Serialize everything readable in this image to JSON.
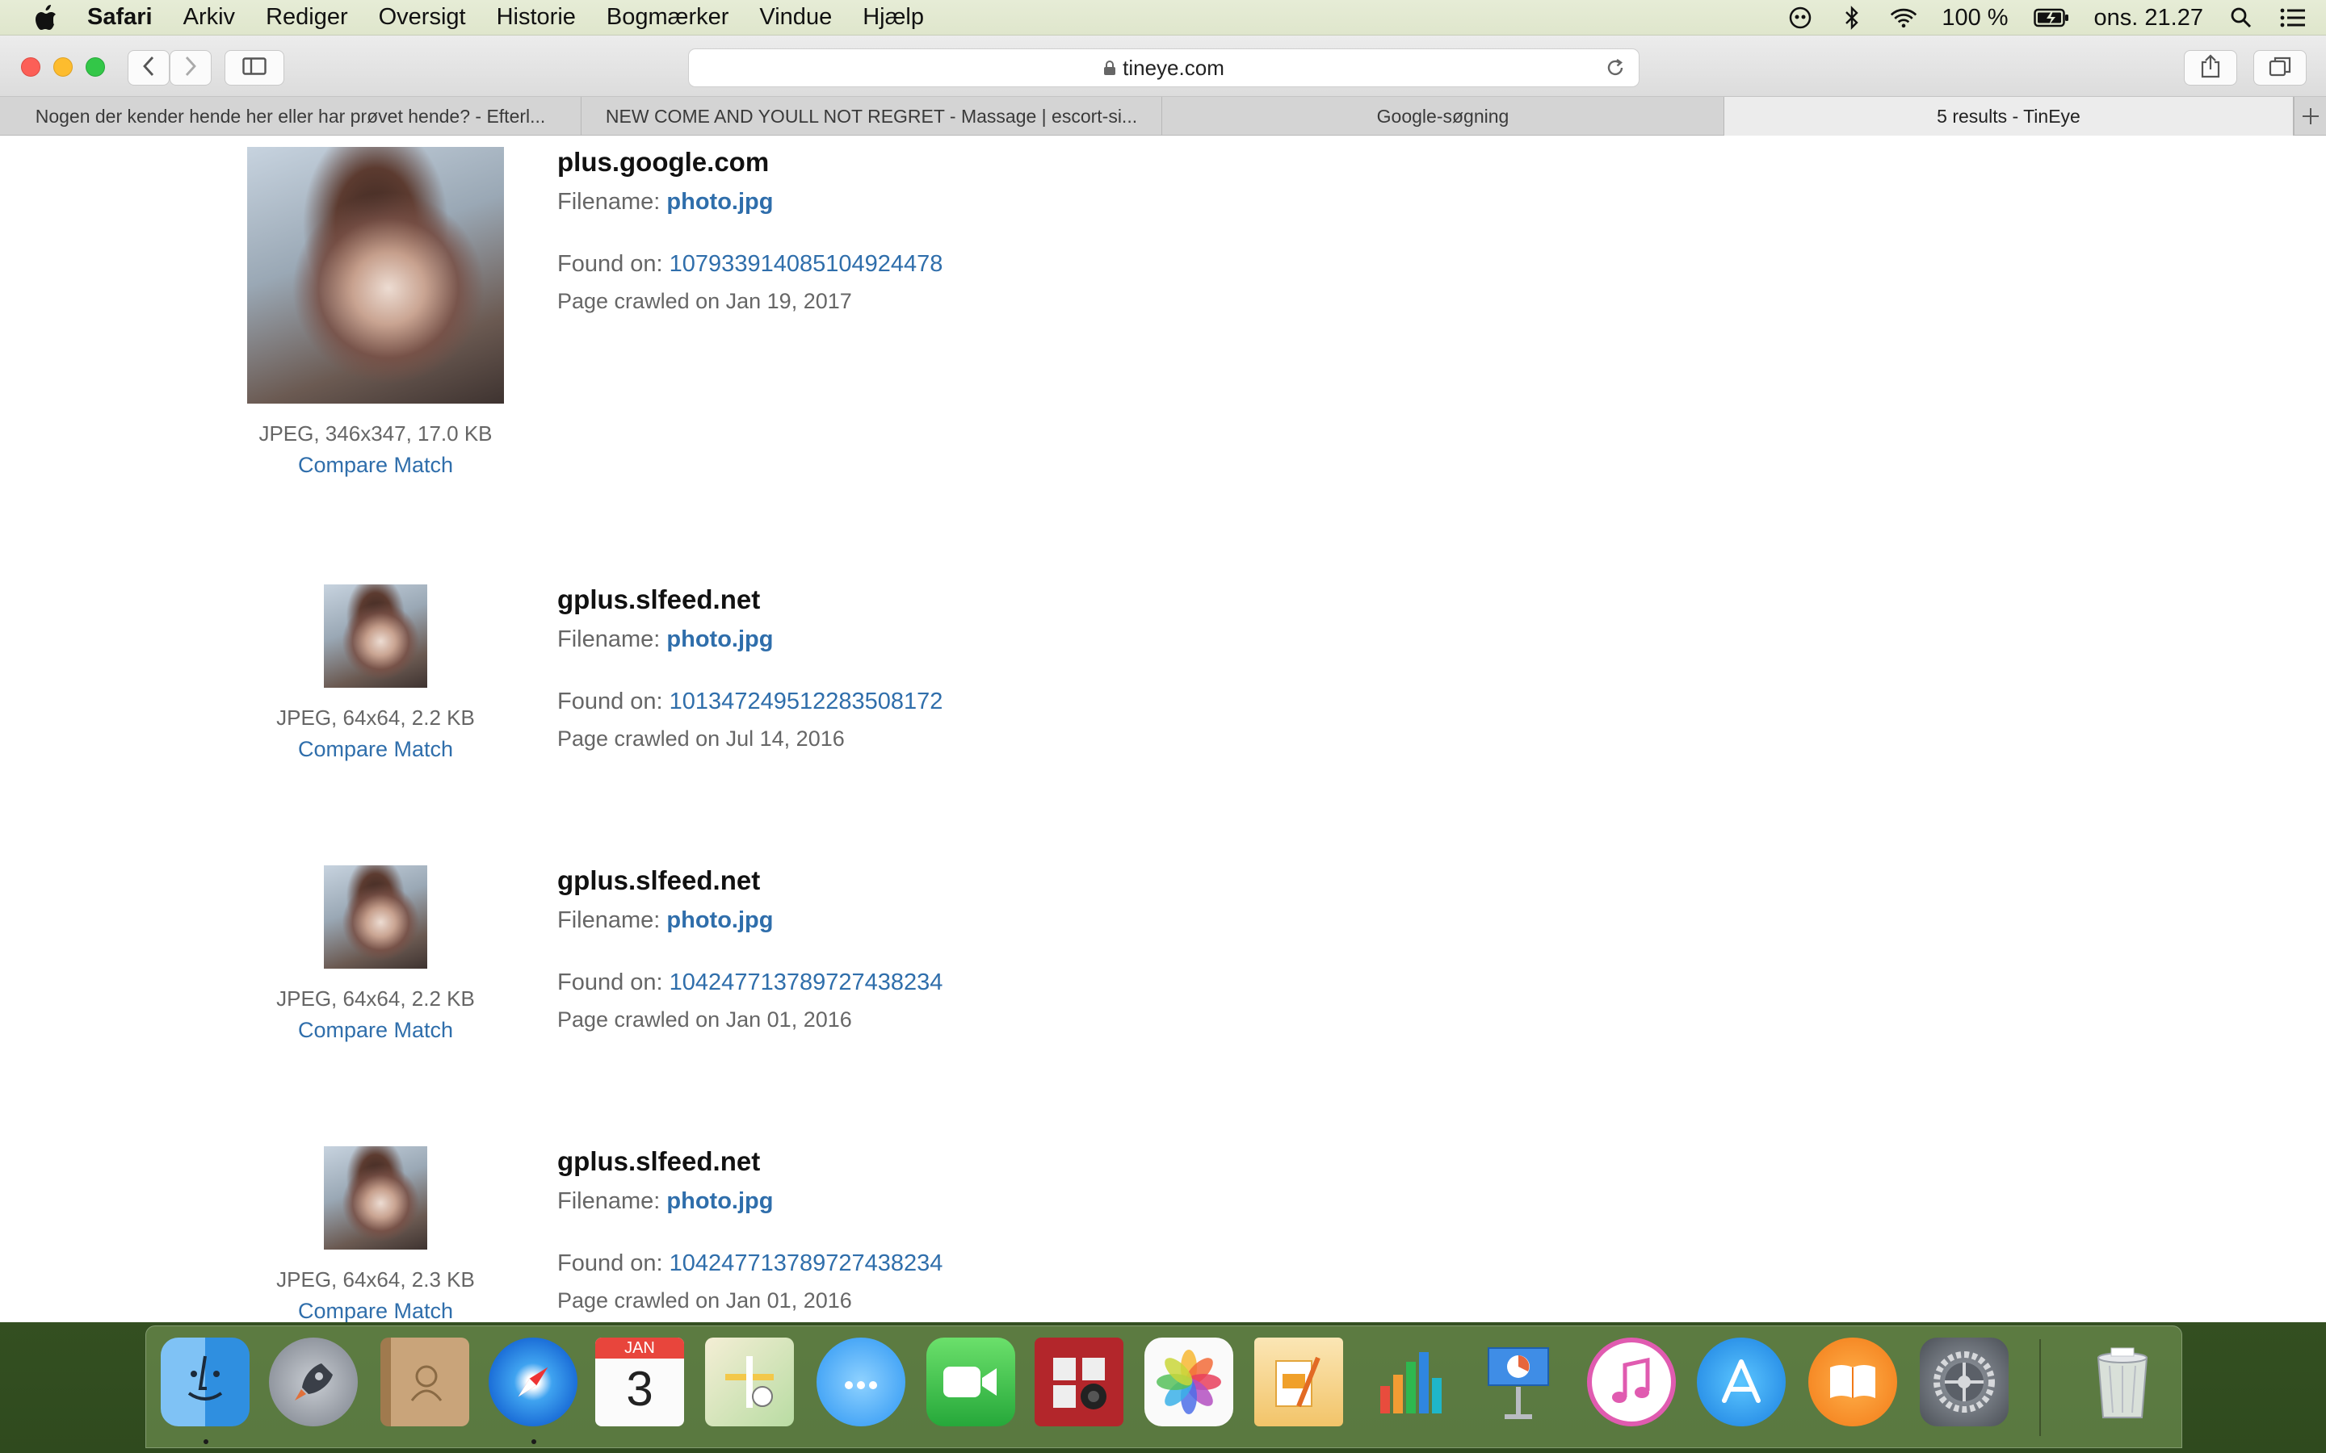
{
  "menubar": {
    "app": "Safari",
    "items": [
      "Arkiv",
      "Rediger",
      "Oversigt",
      "Historie",
      "Bogmærker",
      "Vindue",
      "Hjælp"
    ],
    "battery": "100 %",
    "clock": "ons. 21.27"
  },
  "toolbar": {
    "url": "tineye.com"
  },
  "tabs": [
    {
      "label": "Nogen der kender hende her eller har prøvet hende? - Efterl..."
    },
    {
      "label": "NEW COME AND YOULL NOT REGRET - Massage | escort-si..."
    },
    {
      "label": "Google-søgning"
    },
    {
      "label": "5 results - TinEye"
    }
  ],
  "results": [
    {
      "domain": "plus.google.com",
      "filename_label": "Filename:",
      "filename": "photo.jpg",
      "found_label": "Found on:",
      "found": "107933914085104924478",
      "crawled": "Page crawled on Jan 19, 2017",
      "meta": "JPEG, 346x347, 17.0 KB",
      "compare": "Compare Match"
    },
    {
      "domain": "gplus.slfeed.net",
      "filename_label": "Filename:",
      "filename": "photo.jpg",
      "found_label": "Found on:",
      "found": "101347249512283508172",
      "crawled": "Page crawled on Jul 14, 2016",
      "meta": "JPEG, 64x64, 2.2 KB",
      "compare": "Compare Match"
    },
    {
      "domain": "gplus.slfeed.net",
      "filename_label": "Filename:",
      "filename": "photo.jpg",
      "found_label": "Found on:",
      "found": "104247713789727438234",
      "crawled": "Page crawled on Jan 01, 2016",
      "meta": "JPEG, 64x64, 2.2 KB",
      "compare": "Compare Match"
    },
    {
      "domain": "gplus.slfeed.net",
      "filename_label": "Filename:",
      "filename": "photo.jpg",
      "found_label": "Found on:",
      "found": "104247713789727438234",
      "crawled": "Page crawled on Jan 01, 2016",
      "meta": "JPEG, 64x64, 2.3 KB",
      "compare": "Compare Match"
    }
  ],
  "dock": {
    "calendar_month": "JAN",
    "calendar_day": "3",
    "apps": [
      "Finder",
      "Launchpad",
      "Contacts",
      "Safari",
      "Calendar",
      "Maps",
      "Messages",
      "FaceTime",
      "Photo Booth",
      "Photos",
      "Pages",
      "Numbers",
      "Keynote",
      "iTunes",
      "App Store",
      "iBooks",
      "System Preferences",
      "Trash"
    ]
  }
}
